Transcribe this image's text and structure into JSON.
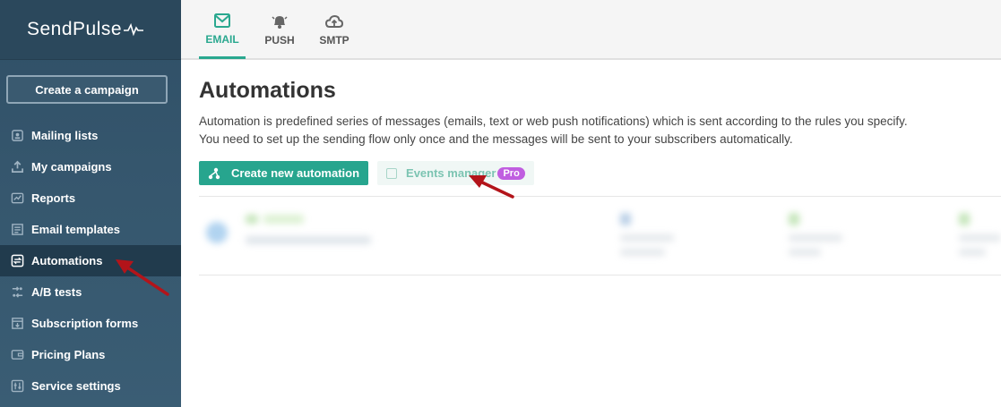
{
  "brand": {
    "name": "SendPulse"
  },
  "sidebar": {
    "create_campaign": "Create a campaign",
    "items": [
      {
        "label": "Mailing lists",
        "icon": "mailing-list-icon"
      },
      {
        "label": "My campaigns",
        "icon": "upload-icon"
      },
      {
        "label": "Reports",
        "icon": "reports-icon"
      },
      {
        "label": "Email templates",
        "icon": "templates-icon"
      },
      {
        "label": "Automations",
        "icon": "automations-icon",
        "active": true
      },
      {
        "label": "A/B tests",
        "icon": "ab-tests-icon"
      },
      {
        "label": "Subscription forms",
        "icon": "forms-icon"
      },
      {
        "label": "Pricing Plans",
        "icon": "wallet-icon"
      },
      {
        "label": "Service settings",
        "icon": "settings-icon"
      }
    ]
  },
  "tabs": [
    {
      "label": "EMAIL",
      "icon": "email-icon",
      "active": true
    },
    {
      "label": "PUSH",
      "icon": "bell-icon"
    },
    {
      "label": "SMTP",
      "icon": "cloud-upload-icon"
    }
  ],
  "main": {
    "title": "Automations",
    "description_line1": "Automation is predefined series of messages (emails, text or web push notifications) which is sent according to the rules you specify.",
    "description_line2": "You need to set up the sending flow only once and the messages will be sent to your subscribers automatically.",
    "create_automation": "Create new automation",
    "events_manager": "Events manager",
    "pro_badge": "Pro"
  },
  "colors": {
    "accent": "#27a58e",
    "sidebar": "#35566d",
    "sidebar_active": "#213b4d",
    "pro": "#c05ee0",
    "annotation": "#b3141a"
  }
}
